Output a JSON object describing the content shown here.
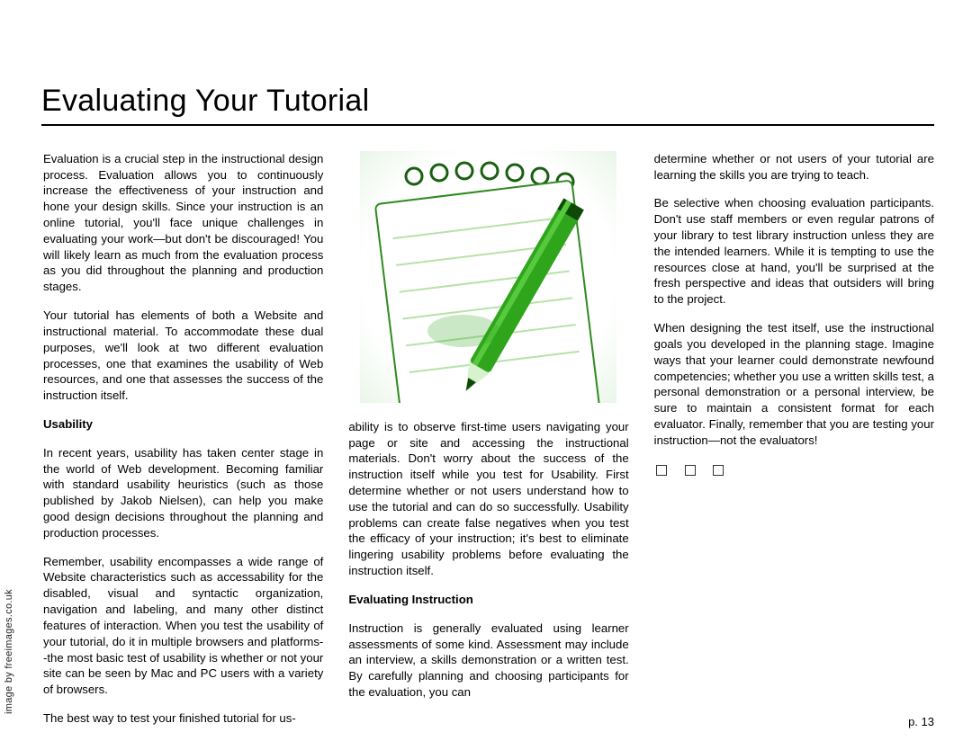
{
  "title": "Evaluating Your Tutorial",
  "credit": "image by freeimages.co.uk",
  "page_label": "p. 13",
  "col1": {
    "p1": "Evaluation is a crucial step in the instructional design process. Evaluation allows you to continuously increase the effectiveness of your instruction and hone your design skills. Since your instruction is an online tutorial, you'll face unique challenges in evaluating your work—but don't be discouraged! You will likely learn as much from the evaluation process as you did throughout the planning and production stages.",
    "p2": "Your tutorial has elements of both a Website and instructional material. To accommodate these dual purposes, we'll look at two different evaluation processes, one that examines the usability of Web resources, and one that assesses the success of the instruction itself.",
    "h1": "Usability",
    "p3": "In recent years, usability has taken center stage in the world of Web development. Becoming familiar with standard usability heuristics (such as those published by Jakob Nielsen), can help you make good design decisions throughout the planning and production processes.",
    "p4": "Remember, usability encompasses a wide range of Website characteristics such as accessability for the disabled, visual and syntactic organization, navigation and labeling, and many other distinct features of interaction. When you test the usability of your tutorial, do it in multiple browsers and platforms--the most basic test of usability is whether or not your site can be seen by Mac and PC users with a variety of browsers.",
    "p5": "The best way to test your finished tutorial for us-"
  },
  "col2": {
    "p1": "ability is to observe first-time users navigating your page or site and accessing the instructional materials. Don't worry about the success of the instruction itself while you test for Usability. First determine whether or not users understand how to use the tutorial and can do so successfully. Usability problems can create false negatives when you test the efficacy of your instruction; it's best to eliminate lingering usability problems before evaluating the instruction itself.",
    "h1": "Evaluating Instruction",
    "p2": "Instruction is generally evaluated using learner assessments of some kind. Assessment may include an interview, a skills demonstration or a written test. By carefully planning and choosing participants for the evaluation, you can"
  },
  "col3": {
    "p1": "determine whether or not users of your tutorial are learning the skills you are trying to teach.",
    "p2": "Be selective when choosing evaluation participants. Don't use staff members or even regular patrons of your library to test library instruction unless they are the intended learners. While it is tempting to use the resources close at hand, you'll be surprised at the fresh perspective and ideas that outsiders will bring to the project.",
    "p3": "When designing the test itself, use the instructional goals you developed in the planning stage. Imagine ways that your learner could demonstrate newfound competencies; whether you use a written skills test, a personal demonstration or a personal interview, be sure to maintain a consistent format for each evaluator. Finally, remember that you are testing your instruction—not the evaluators!"
  }
}
